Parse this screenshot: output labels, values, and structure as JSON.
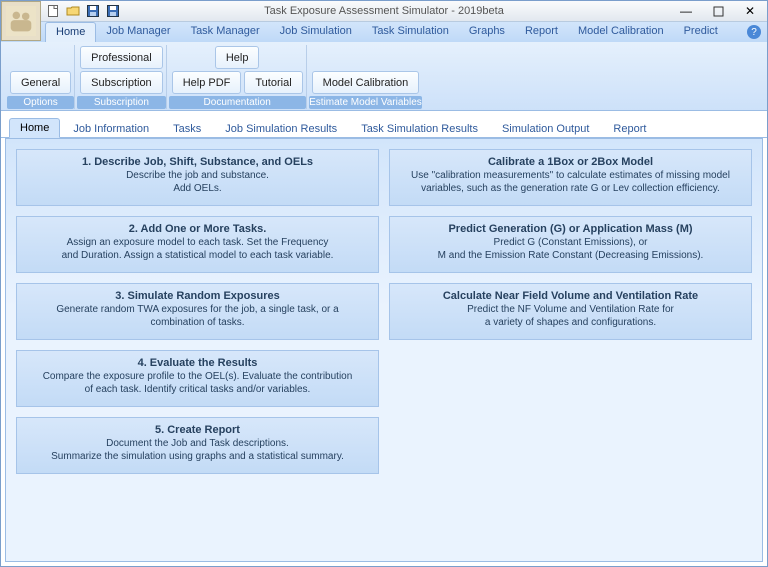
{
  "window": {
    "title": "Task Exposure Assessment Simulator - 2019beta"
  },
  "ribbon": {
    "tabs": [
      "Home",
      "Job Manager",
      "Task Manager",
      "Job Simulation",
      "Task Simulation",
      "Graphs",
      "Report",
      "Model Calibration",
      "Predict"
    ],
    "active_tab": "Home",
    "groups": [
      {
        "title": "Options",
        "rows": [
          [
            ""
          ],
          [
            "General"
          ]
        ],
        "buttons": [
          "General"
        ]
      },
      {
        "title": "Subscription",
        "rows": [
          [
            "Professional"
          ],
          [
            "Subscription"
          ]
        ],
        "buttons": [
          "Professional",
          "Subscription"
        ]
      },
      {
        "title": "Documentation",
        "rows": [
          [
            "Help"
          ],
          [
            "Help PDF",
            "Tutorial"
          ]
        ],
        "buttons": [
          "Help",
          "Help PDF",
          "Tutorial"
        ]
      },
      {
        "title": "Estimate Model Variables",
        "rows": [
          [
            ""
          ],
          [
            "Model Calibration"
          ]
        ],
        "buttons": [
          "Model Calibration"
        ]
      }
    ]
  },
  "content_tabs": [
    "Home",
    "Job Information",
    "Tasks",
    "Job Simulation Results",
    "Task Simulation Results",
    "Simulation Output",
    "Report"
  ],
  "content_active": "Home",
  "cards_left": [
    {
      "title": "1. Describe Job, Shift, Substance, and OELs",
      "desc": "Describe the job and substance.\nAdd OELs."
    },
    {
      "title": "2. Add One or More Tasks.",
      "desc": "Assign an exposure model to each task. Set the Frequency\nand Duration. Assign a statistical model to each task variable."
    },
    {
      "title": "3. Simulate Random Exposures",
      "desc": "Generate random TWA exposures for the job, a single task, or a\ncombination of tasks."
    },
    {
      "title": "4. Evaluate the Results",
      "desc": "Compare the exposure profile to the OEL(s). Evaluate the contribution\nof each task. Identify critical tasks and/or variables."
    },
    {
      "title": "5. Create Report",
      "desc": "Document the Job and Task descriptions.\nSummarize the simulation using graphs and a statistical summary."
    }
  ],
  "cards_right": [
    {
      "title": "Calibrate a 1Box or 2Box Model",
      "desc": "Use \"calibration measurements\" to calculate estimates of missing model\nvariables, such as the generation rate G or Lev collection efficiency."
    },
    {
      "title": "Predict Generation (G) or Application Mass (M)",
      "desc": "Predict G (Constant Emissions), or\nM and the Emission Rate Constant (Decreasing Emissions)."
    },
    {
      "title": "Calculate Near Field Volume and Ventilation Rate",
      "desc": "Predict the NF Volume and Ventilation Rate for\na variety of shapes and configurations."
    }
  ]
}
